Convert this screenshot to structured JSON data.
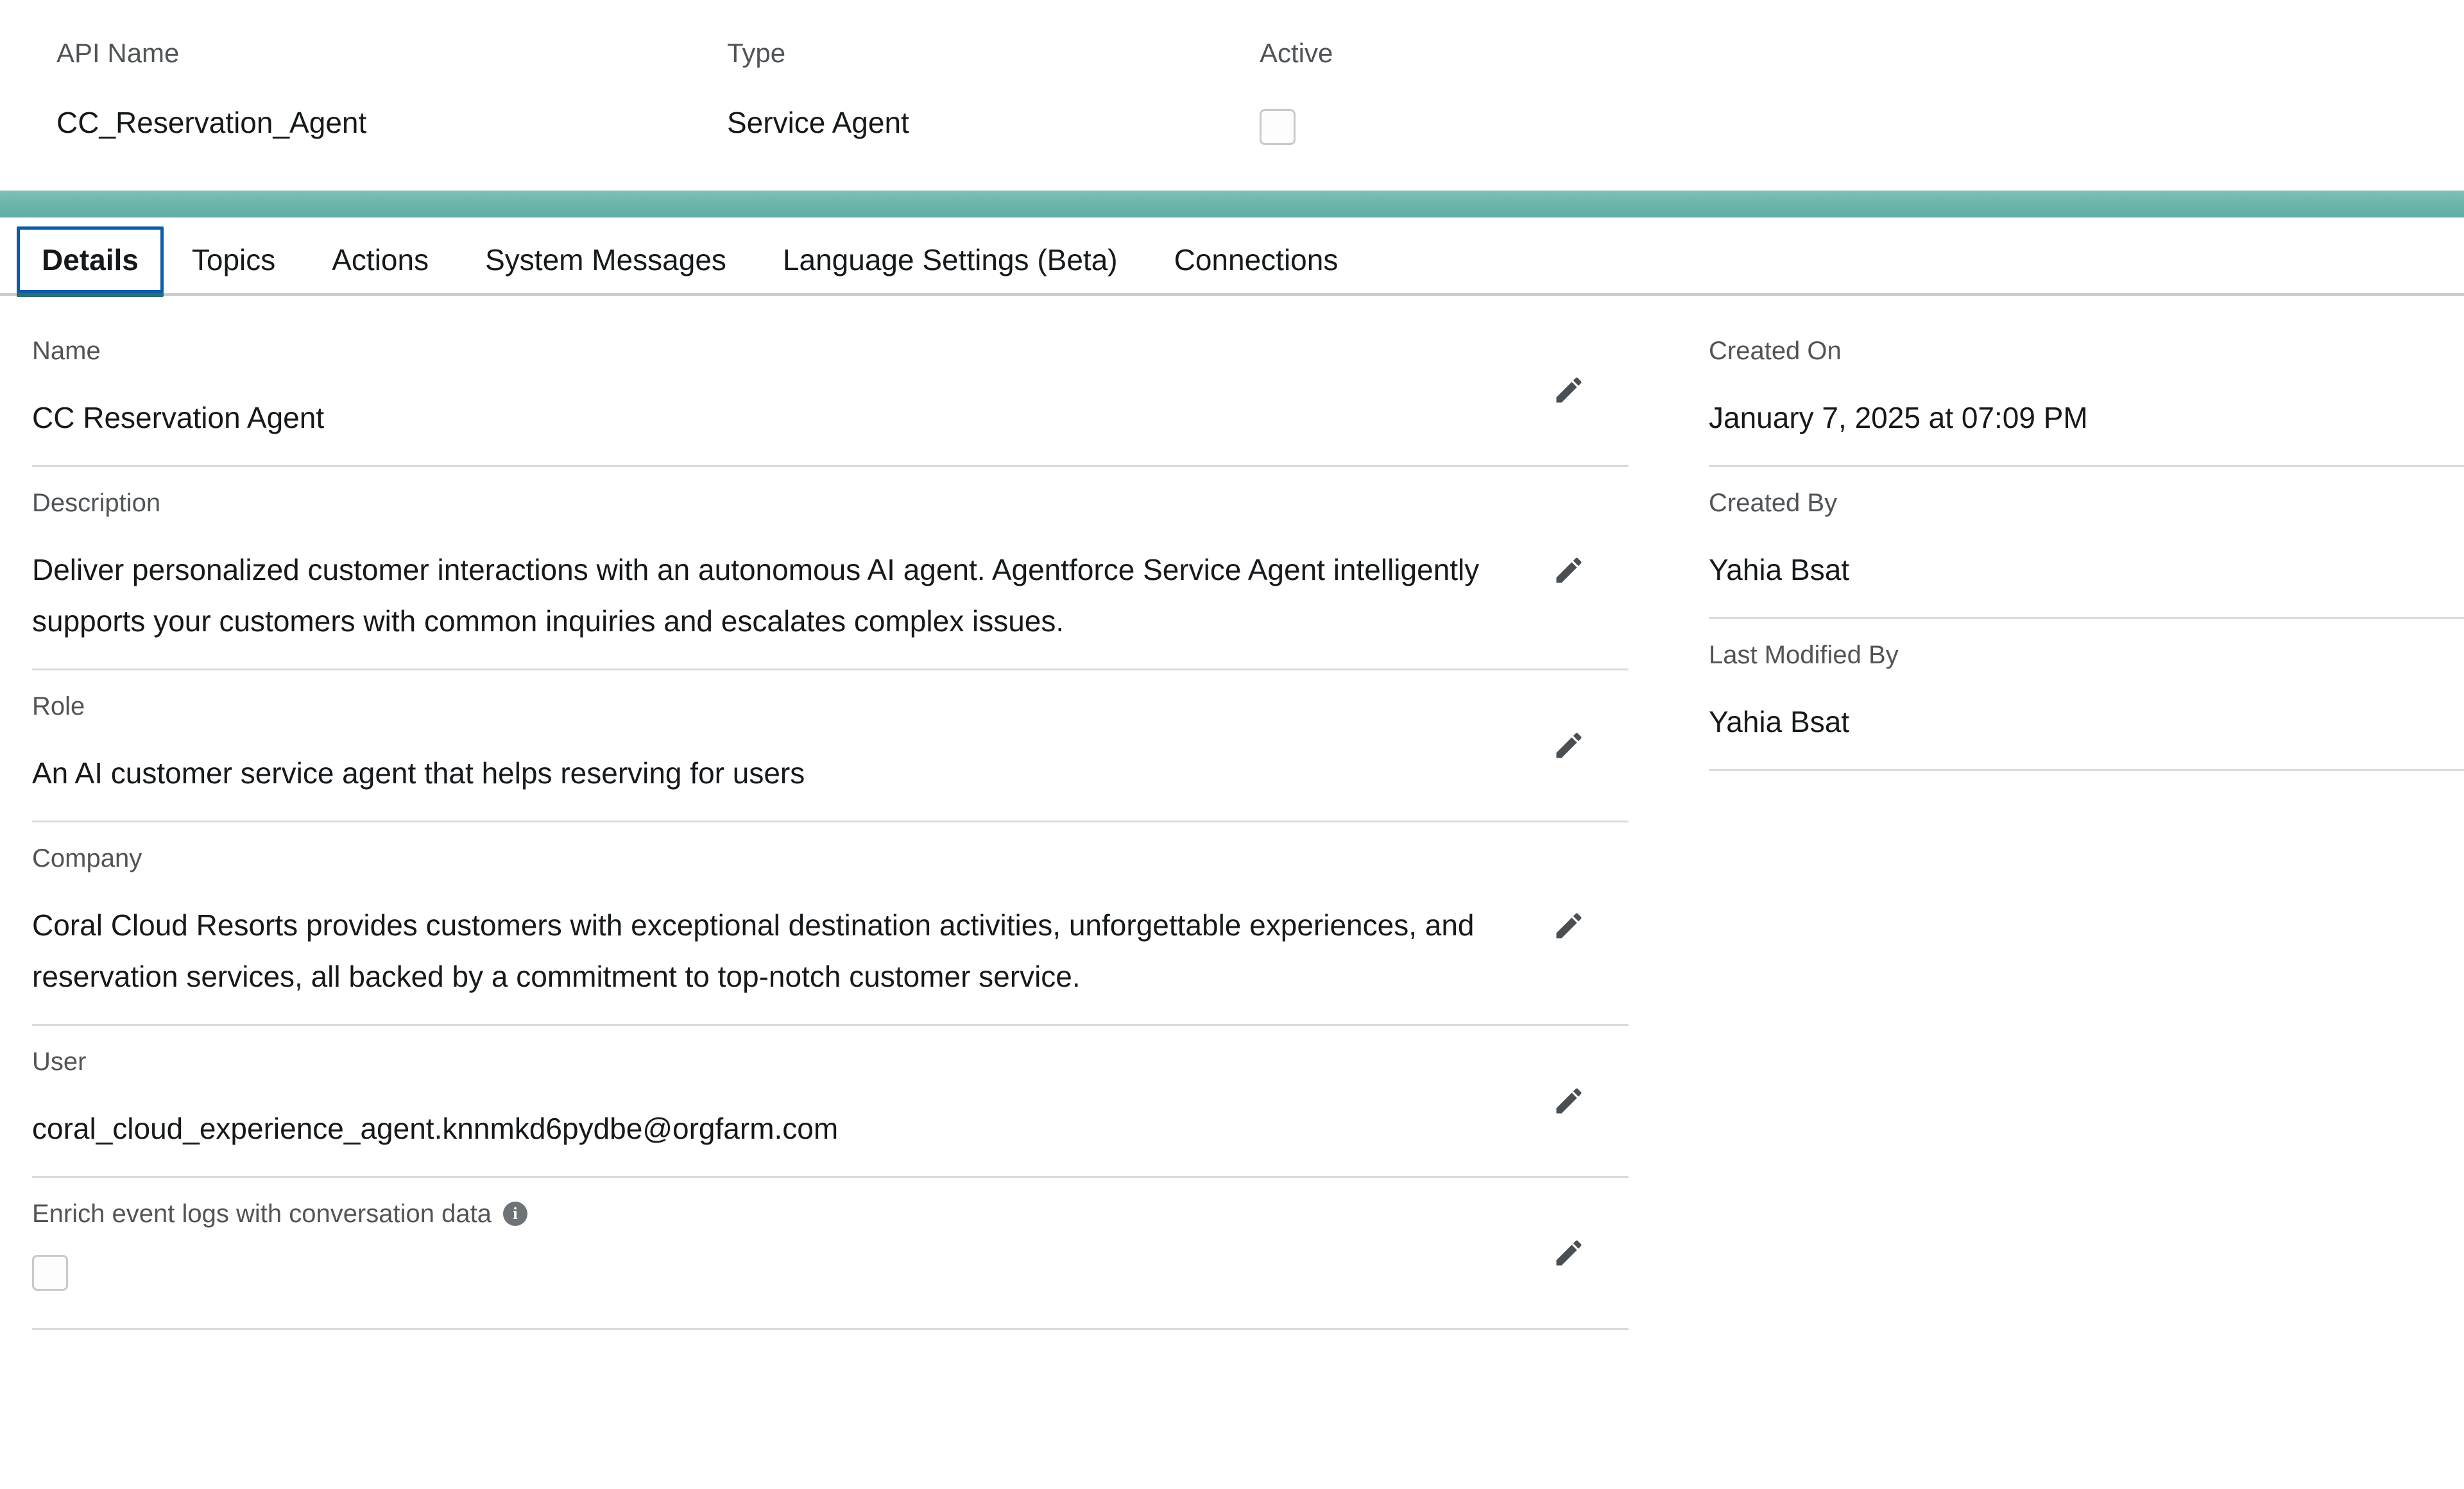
{
  "summary": {
    "api_name": {
      "label": "API Name",
      "value": "CC_Reservation_Agent"
    },
    "type": {
      "label": "Type",
      "value": "Service Agent"
    },
    "active": {
      "label": "Active",
      "checked": false
    }
  },
  "tabs": [
    {
      "label": "Details",
      "active": true
    },
    {
      "label": "Topics",
      "active": false
    },
    {
      "label": "Actions",
      "active": false
    },
    {
      "label": "System Messages",
      "active": false
    },
    {
      "label": "Language Settings (Beta)",
      "active": false
    },
    {
      "label": "Connections",
      "active": false
    }
  ],
  "details": {
    "name": {
      "label": "Name",
      "value": "CC Reservation Agent"
    },
    "description": {
      "label": "Description",
      "value": "Deliver personalized customer interactions with an autonomous AI agent. Agentforce Service Agent intelligently supports your customers with common inquiries and escalates complex issues."
    },
    "role": {
      "label": "Role",
      "value": "An AI customer service agent that helps reserving for users"
    },
    "company": {
      "label": "Company",
      "value": "Coral Cloud Resorts provides customers with exceptional destination activities, unforgettable experiences, and reservation services, all backed by a commitment to top-notch customer service."
    },
    "user": {
      "label": "User",
      "value": "coral_cloud_experience_agent.knnmkd6pydbe@orgfarm.com"
    },
    "enrich_logs": {
      "label": "Enrich event logs with conversation data",
      "info_icon": "info-icon",
      "checked": false
    }
  },
  "meta": {
    "created_on": {
      "label": "Created On",
      "value": "January 7, 2025 at 07:09 PM"
    },
    "created_by": {
      "label": "Created By",
      "value": "Yahia Bsat"
    },
    "last_modified_by": {
      "label": "Last Modified By",
      "value": "Yahia Bsat"
    }
  },
  "colors": {
    "teal_bar": "#6bb4ab",
    "tab_focus": "#0b5cab",
    "tab_underline": "#2e6e73",
    "divider": "#dddbda",
    "label_text": "#515457",
    "value_text": "#16191b"
  },
  "icons": {
    "edit": "pencil-icon",
    "info": "info-icon"
  }
}
